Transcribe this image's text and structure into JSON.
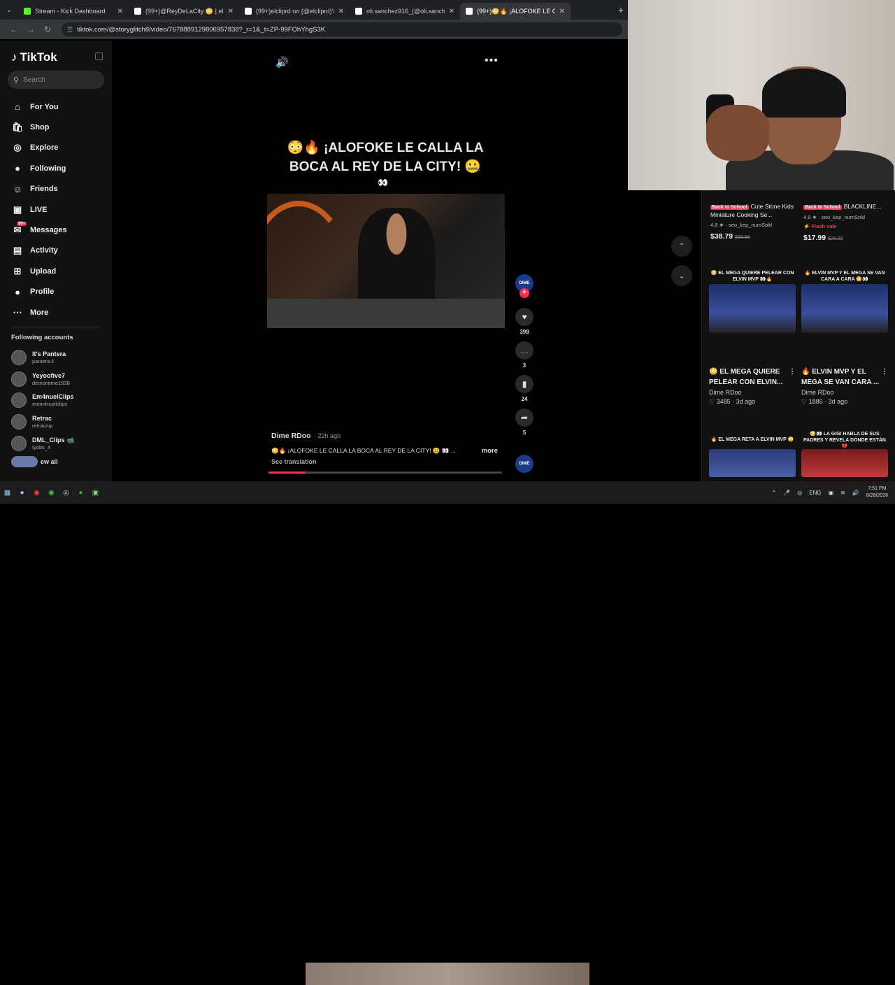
{
  "browser": {
    "tabs": [
      {
        "title": "Stream - Kick Dashboard",
        "fav_color": "#53fc18",
        "active": false
      },
      {
        "title": "(99+)@ReyDeLaCity 😳 | el rey",
        "fav_color": "#ffffff",
        "active": false
      },
      {
        "title": "(99+)elcliprd oo (@elcliprd)'s v",
        "fav_color": "#ffffff",
        "active": false
      },
      {
        "title": "oli.sanchez916_(@oli.sanchez9",
        "fav_color": "#ffffff",
        "active": false
      },
      {
        "title": "(99+)😳🔥 ¡ALOFOKE LE C",
        "fav_color": "#ffffff",
        "active": true
      }
    ],
    "url": "tiktok.com/@storyglitch8/video/7678889129806957838?_r=1&_t=ZP-99FOhYhgS3K"
  },
  "sidebar": {
    "logo": "TikTok",
    "search_placeholder": "Search",
    "nav": [
      {
        "label": "For You",
        "icon": "⌂",
        "name": "nav-for-you",
        "badge": ""
      },
      {
        "label": "Shop",
        "icon": "🛍",
        "name": "nav-shop",
        "badge": ""
      },
      {
        "label": "Explore",
        "icon": "◎",
        "name": "nav-explore",
        "badge": ""
      },
      {
        "label": "Following",
        "icon": "●",
        "name": "nav-following",
        "badge": ""
      },
      {
        "label": "Friends",
        "icon": "☺",
        "name": "nav-friends",
        "badge": ""
      },
      {
        "label": "LIVE",
        "icon": "▣",
        "name": "nav-live",
        "badge": ""
      },
      {
        "label": "Messages",
        "icon": "✉",
        "name": "nav-messages",
        "badge": "99+"
      },
      {
        "label": "Activity",
        "icon": "▤",
        "name": "nav-activity",
        "badge": ""
      },
      {
        "label": "Upload",
        "icon": "⊞",
        "name": "nav-upload",
        "badge": ""
      },
      {
        "label": "Profile",
        "icon": "●",
        "name": "nav-profile",
        "badge": ""
      },
      {
        "label": "More",
        "icon": "⋯",
        "name": "nav-more",
        "badge": ""
      }
    ],
    "following_header": "Following accounts",
    "following": [
      {
        "name": "It's Pantera",
        "handle": "pantera.ll"
      },
      {
        "name": "Yeyoofive7",
        "handle": "demontime1838"
      },
      {
        "name": "Em4nuelClips",
        "handle": "emm4nuelclips"
      },
      {
        "name": "Retrac",
        "handle": "retracmp"
      },
      {
        "name": "DML_Clips 📹",
        "handle": "tyobs_4"
      }
    ],
    "view_all": "ew all"
  },
  "video": {
    "title": "😳🔥 ¡ALOFOKE LE CALLA LA BOCA AL REY DE LA CITY! 🤐",
    "eyes": "👀",
    "author": "Dime RDoo",
    "ago": "· 22h ago",
    "description": "😳🔥 ¡ALOFOKE LE CALLA LA BOCA AL REY DE LA CITY! 🤐 👀 ...",
    "more": "more",
    "see_translation": "See translation",
    "progress": 0.16,
    "creator_badge": "DIME",
    "actions": [
      {
        "name": "like-button",
        "icon": "♥",
        "count": "398"
      },
      {
        "name": "comment-button",
        "icon": "…",
        "count": "3"
      },
      {
        "name": "bookmark-button",
        "icon": "▮",
        "count": "24"
      },
      {
        "name": "share-button",
        "icon": "➦",
        "count": "5"
      }
    ]
  },
  "right_panel": {
    "products": [
      {
        "tag": "Back to School",
        "title": "Cute Stone Kids Miniature Cooking Se...",
        "rating": "4.8 ★ · seo_kep_numSold",
        "flash": "",
        "price": "$38.79",
        "old_price": "$59.99"
      },
      {
        "tag": "Back to School",
        "title": "BLACKLINE...",
        "rating": "4.9 ★ · seo_kep_numSold",
        "flash": "⚡ Flash sale",
        "price": "$17.99",
        "old_price": "$26.00"
      }
    ],
    "videos": [
      {
        "caption": "😳 EL MEGA QUIERE PELEAR CON ELVIN MVP 👀🔥",
        "title": "😳 EL MEGA QUIERE PELEAR CON ELVIN...",
        "author": "Dime RDoo",
        "stats": "♡ 3485 · 3d ago"
      },
      {
        "caption": "🔥 ELVIN MVP Y EL MEGA SE VAN CARA A CARA 😳👀",
        "title": "🔥 ELVIN MVP Y EL MEGA SE VAN CARA ...",
        "author": "Dime RDoo",
        "stats": "♡ 1885 · 3d ago"
      },
      {
        "caption": "🔥 EL MEGA RETA A ELVIN MVP 😳",
        "title": "",
        "author": "",
        "stats": ""
      },
      {
        "caption": "😳👀 LA GIGI HABLA DE SUS PADRES Y REVELA DÓNDE ESTÁN 💔",
        "title": "",
        "author": "",
        "stats": ""
      }
    ]
  },
  "taskbar": {
    "lang": "ENG",
    "time": "7:51 PM",
    "date": "8/28/2026"
  }
}
